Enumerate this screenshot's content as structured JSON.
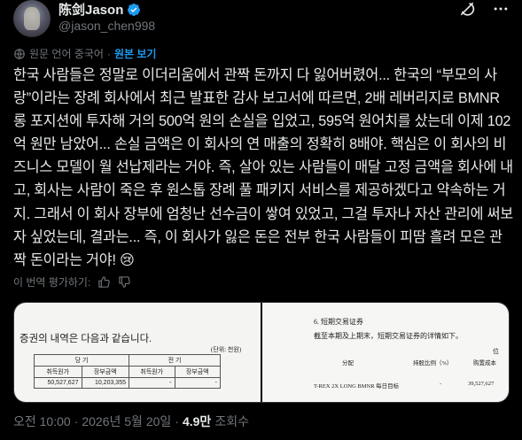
{
  "author": {
    "name": "陈剑Jason",
    "handle": "@jason_chen998"
  },
  "translation": {
    "source_label": "원문 언어 중국어",
    "separator": "·",
    "show_original": "원본 보기"
  },
  "post": {
    "text": "한국 사람들은 정말로 이더리움에서 관짝 돈까지 다 잃어버렸어... 한국의 “부모의 사랑”이라는 장례 회사에서 최근 발표한 감사 보고서에 따르면, 2배 레버리지로 BMNR 롱 포지션에 투자해 거의 500억 원의 손실을 입었고, 595억 원어치를 샀는데 이제 102억 원만 남았어... 손실 금액은 이 회사의 연 매출의 정확히 8배야. 핵심은 이 회사의 비즈니스 모델이 월 선납제라는 거야. 즉, 살아 있는 사람들이 매달 고정 금액을 회사에 내고, 회사는 사람이 죽은 후 원스톱 장례 풀 패키지 서비스를 제공하겠다고 약속하는 거지. 그래서 이 회사 장부에 엄청난 선수금이 쌓여 있었고, 그걸 투자나 자산 관리에 써보자 싶었는데, 결과는... 즉, 이 회사가 잃은 돈은 전부 한국 사람들이 피땀 흘려 모은 관짝 돈이라는 거야! 😢"
  },
  "rating": {
    "label": "이 번역 평가하기:"
  },
  "media": {
    "left": {
      "heading": "증권의 내역은 다음과 같습니다.",
      "unit": "(단위: 천원)",
      "col_current": "당   기",
      "col_prior": "전   기",
      "sub_cost": "취득원가",
      "sub_book": "장부금액",
      "row_cost": "50,527,627",
      "row_book": "10,203,355",
      "dash1": "-",
      "dash2": "-"
    },
    "right": {
      "title": "6. 短期交易证券",
      "subtitle": "截至本期及上期末，短期交易证券的详情如下。",
      "unit": "位",
      "col_type": "分配",
      "col_ratio": "持股比例（%）",
      "col_cost": "购置成本",
      "row_name": "T-REX 2X LONG BMNR 每日目标",
      "row_dash": "-",
      "row_value": "39,527,627"
    }
  },
  "footer": {
    "time": "오전 10:00",
    "dot": "·",
    "date": "2026년 5월 20일",
    "views": "4.9만",
    "views_label": "조회수"
  }
}
